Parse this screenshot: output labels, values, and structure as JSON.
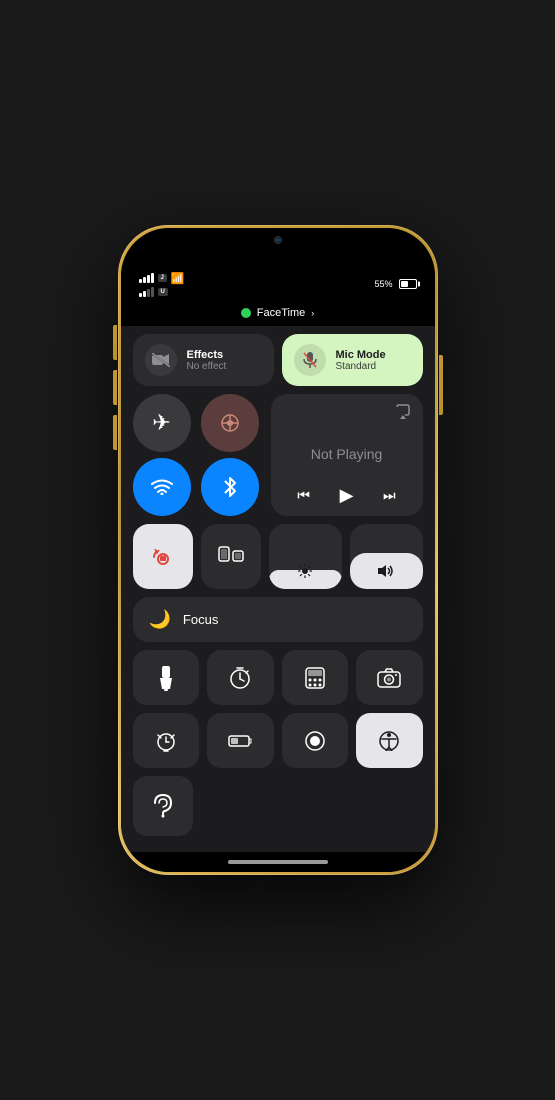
{
  "phone": {
    "facetime": {
      "label": "FaceTime",
      "chevron": "›",
      "active": true
    },
    "statusBar": {
      "battery_percent": "55%",
      "carrier1_badge": "J",
      "carrier2_badge": "U"
    },
    "controlCenter": {
      "effects": {
        "title": "Effects",
        "subtitle": "No effect"
      },
      "micMode": {
        "title": "Mic Mode",
        "subtitle": "Standard"
      },
      "nowPlaying": {
        "status": "Not Playing"
      },
      "focus": {
        "label": "Focus"
      },
      "network": {
        "airplane": "✈",
        "cellular": "",
        "wifi": "",
        "bluetooth": ""
      },
      "sliders": {
        "brightness_pct": 30,
        "volume_pct": 55
      }
    }
  }
}
